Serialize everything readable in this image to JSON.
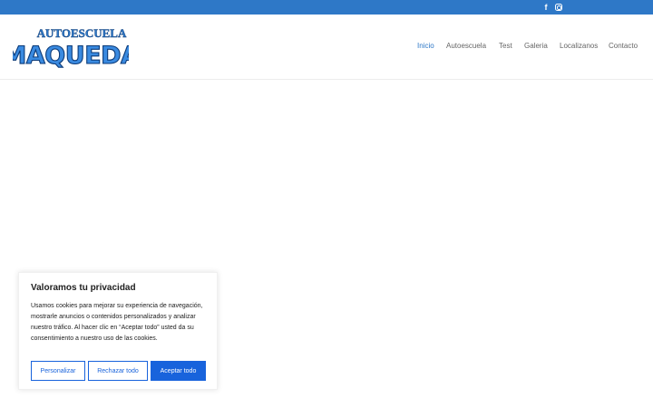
{
  "topbar": {
    "social": [
      {
        "icon": "facebook-icon",
        "glyph": "f"
      },
      {
        "icon": "instagram-icon",
        "glyph": ""
      }
    ],
    "color": "#2e78c7"
  },
  "logo": {
    "line1": "AUTOESCUELA",
    "line2": "MAQUEDA",
    "color": "#2e78c7"
  },
  "nav": {
    "items": [
      {
        "label": "Inicio",
        "active": true
      },
      {
        "label": "Autoescuela",
        "active": false
      },
      {
        "label": "Test",
        "active": false
      },
      {
        "label": "Galeria",
        "active": false
      },
      {
        "label": "Localizanos",
        "active": false
      },
      {
        "label": "Contacto",
        "active": false
      }
    ]
  },
  "cookie": {
    "title": "Valoramos tu privacidad",
    "body": "Usamos cookies para mejorar su experiencia de navegación, mostrarle anuncios o contenidos personalizados y analizar nuestro tráfico. Al hacer clic en “Aceptar todo” usted da su consentimiento a nuestro uso de las cookies.",
    "buttons": {
      "customize": "Personalizar",
      "reject": "Rechazar todo",
      "accept": "Aceptar todo"
    },
    "accent": "#1863dc"
  }
}
